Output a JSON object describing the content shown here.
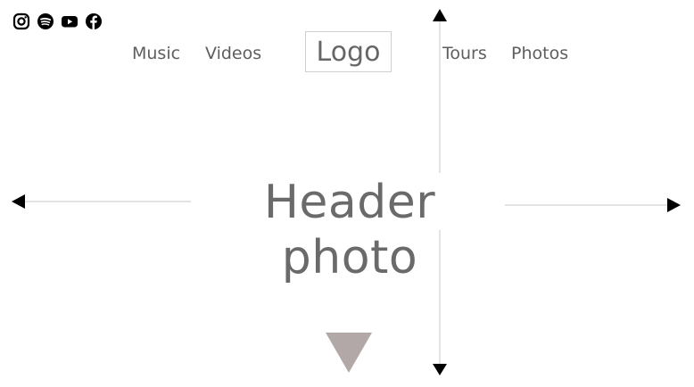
{
  "social": [
    {
      "icon": "instagram-icon"
    },
    {
      "icon": "spotify-icon"
    },
    {
      "icon": "youtube-icon"
    },
    {
      "icon": "facebook-icon"
    }
  ],
  "nav": {
    "music": "Music",
    "videos": "Videos",
    "tours": "Tours",
    "photos": "Photos"
  },
  "logo": "Logo",
  "header": {
    "title": "Header photo"
  },
  "colors": {
    "text": "#5e5e5e",
    "arrow_line": "#c8c8c8",
    "arrow_head": "#000000",
    "scroll_triangle": "#b3a8a8"
  }
}
